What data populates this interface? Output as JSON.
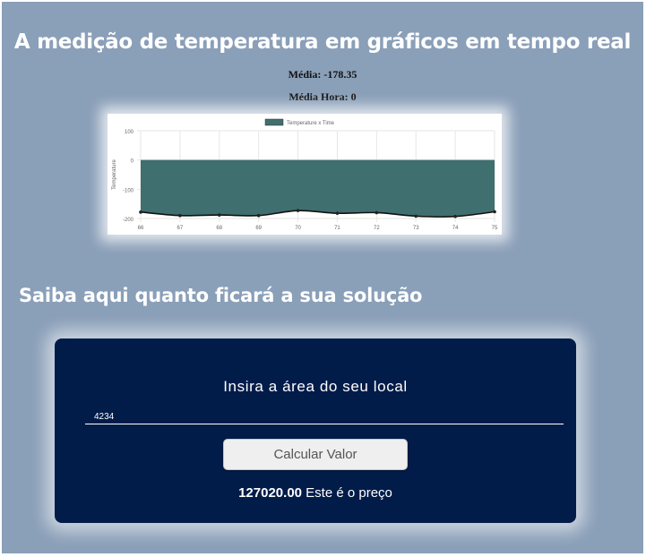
{
  "header": {
    "title": "A medição de temperatura em gráficos em tempo real"
  },
  "stats": {
    "media": "Média: -178.35",
    "media_hora": "Média Hora: 0"
  },
  "chart_data": {
    "type": "area",
    "legend": "Temperature x Time",
    "legend_color": "#3f6f6e",
    "ylabel": "Temperature",
    "xlabel": "",
    "x": [
      66,
      67,
      68,
      69,
      70,
      71,
      72,
      73,
      74,
      75
    ],
    "y": [
      -178,
      -190,
      -188,
      -190,
      -173,
      -182,
      -180,
      -192,
      -193,
      -177
    ],
    "ylim": [
      -200,
      100
    ],
    "yticks": [
      100,
      0,
      -100,
      -200
    ],
    "fill_color": "#3f6f6e",
    "line_color": "#111111",
    "grid": true
  },
  "calculator": {
    "section_title": "Saiba aqui quanto ficará a sua solução",
    "heading": "Insira a área do seu local",
    "input_value": "4234",
    "button_label": "Calcular Valor",
    "result_value": "127020.00",
    "result_text": " Este é o preço",
    "card_color": "#021c4a",
    "page_background": "#8a9fb8"
  }
}
